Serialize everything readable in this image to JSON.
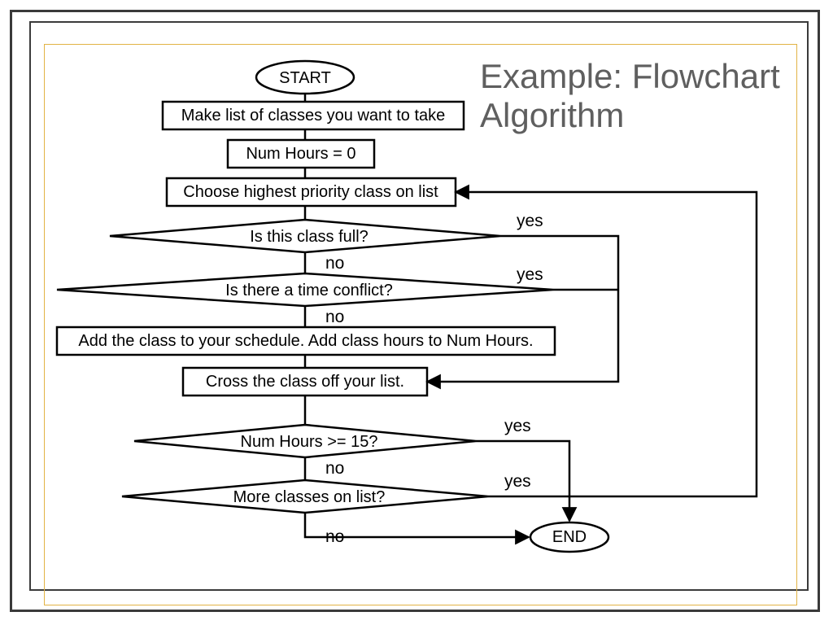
{
  "title_line1": "Example: Flowchart",
  "title_line2": "Algorithm",
  "nodes": {
    "start": "START",
    "step1": "Make list of classes you want to take",
    "step2": "Num Hours = 0",
    "step3": "Choose highest priority class on list",
    "dec1": "Is this class full?",
    "dec2": "Is there a time conflict?",
    "step4": "Add the class to your schedule. Add class hours to Num Hours.",
    "step5": "Cross the class off your list.",
    "dec3": "Num Hours >= 15?",
    "dec4": "More classes on list?",
    "end": "END"
  },
  "labels": {
    "yes": "yes",
    "no": "no"
  }
}
